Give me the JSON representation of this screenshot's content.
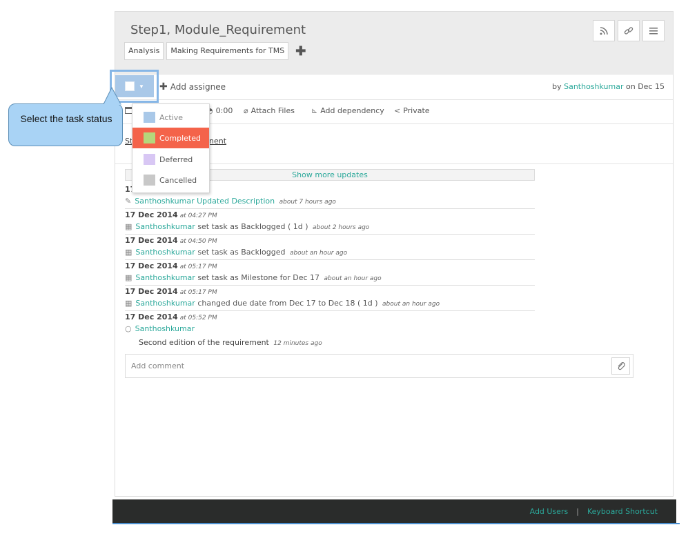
{
  "task": {
    "title": "Step1, Module_Requirement",
    "tags": [
      "Analysis",
      "Making Requirements for TMS"
    ],
    "add_tag_icon": "plus-icon",
    "header_actions": [
      "rss-icon",
      "link-icon",
      "menu-icon"
    ]
  },
  "assign": {
    "add_assignee_label": "Add assignee",
    "by_prefix": "by",
    "creator": "Santhoshkumar",
    "date_text": "on Dec 15"
  },
  "meta": {
    "time": "0:00",
    "attach_files": "Attach Files",
    "add_dependency": "Add dependency",
    "privacy": "Private"
  },
  "description": {
    "text_visible_left": "St",
    "text_visible_right": "nent"
  },
  "status_dropdown": {
    "options": [
      {
        "label": "Active",
        "color": "#a9c8e8"
      },
      {
        "label": "Completed",
        "color": "#b5d77b"
      },
      {
        "label": "Deferred",
        "color": "#d8c7f4"
      },
      {
        "label": "Cancelled",
        "color": "#c8c8c8"
      }
    ],
    "highlighted": "Completed",
    "highlight_color": "#f4634a"
  },
  "callout": {
    "text": "Select the task status"
  },
  "activity": {
    "show_more": "Show more updates",
    "first_date_partial": "17",
    "entries": [
      {
        "user": "Santhoshkumar",
        "action": "Updated Description",
        "ago": "about 7 hours ago",
        "icon": "pencil-icon"
      },
      {
        "date": "17 Dec 2014",
        "at": "at 04:27 PM",
        "user": "Santhoshkumar",
        "action": "set task as Backlogged ( 1d )",
        "ago": "about 2 hours ago",
        "icon": "calendar-icon"
      },
      {
        "date": "17 Dec 2014",
        "at": "at 04:50 PM",
        "user": "Santhoshkumar",
        "action": "set task as Backlogged",
        "ago": "about an hour ago",
        "icon": "calendar-icon"
      },
      {
        "date": "17 Dec 2014",
        "at": "at 05:17 PM",
        "user": "Santhoshkumar",
        "action": "set task as Milestone for Dec 17",
        "ago": "about an hour ago",
        "icon": "calendar-icon"
      },
      {
        "date": "17 Dec 2014",
        "at": "at 05:17 PM",
        "user": "Santhoshkumar",
        "action": "changed due date from Dec 17 to Dec 18 ( 1d )",
        "ago": "about an hour ago",
        "icon": "calendar-icon"
      }
    ],
    "comment": {
      "date": "17 Dec 2014",
      "at": "at 05:52 PM",
      "user": "Santhoshkumar",
      "text": "Second edition of the requirement",
      "ago": "12 minutes ago"
    }
  },
  "comment_box": {
    "placeholder": "Add comment"
  },
  "footer": {
    "add_users": "Add Users",
    "separator": "|",
    "keyboard_shortcut": "Keyboard Shortcut"
  },
  "colors": {
    "accent": "#2aa89a",
    "footer_bg": "#2a2c2b"
  }
}
